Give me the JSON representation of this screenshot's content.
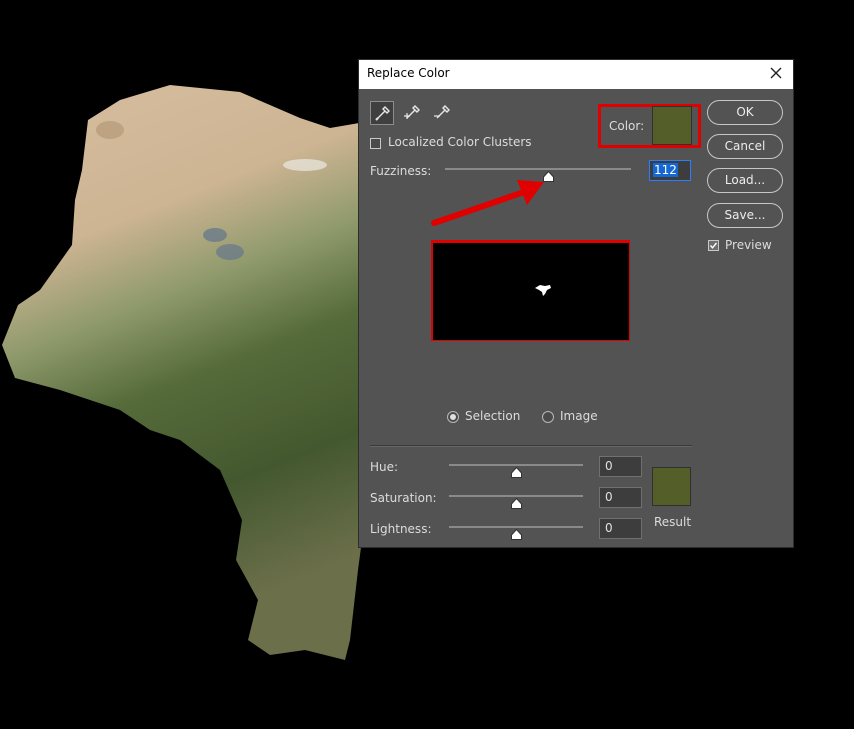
{
  "dialog": {
    "title": "Replace Color",
    "localized_label": "Localized Color Clusters",
    "localized_checked": false,
    "color_label": "Color:",
    "color_value": "#535e29",
    "fuzziness_label": "Fuzziness:",
    "fuzziness_value": "112",
    "fuzziness_max": 200,
    "view_options": {
      "selection": "Selection",
      "image": "Image",
      "selected": "selection"
    },
    "hue_label": "Hue:",
    "hue_value": "0",
    "saturation_label": "Saturation:",
    "saturation_value": "0",
    "lightness_label": "Lightness:",
    "lightness_value": "0",
    "result_label": "Result",
    "buttons": {
      "ok": "OK",
      "cancel": "Cancel",
      "load": "Load...",
      "save": "Save..."
    },
    "preview_label": "Preview",
    "preview_checked": true
  },
  "icons": [
    "eyedropper-icon",
    "eyedropper-plus-icon",
    "eyedropper-minus-icon",
    "close-icon",
    "check-icon"
  ],
  "colors": {
    "highlight": "#e00000",
    "dialog_bg": "#535353",
    "accent": "#1468d4"
  }
}
